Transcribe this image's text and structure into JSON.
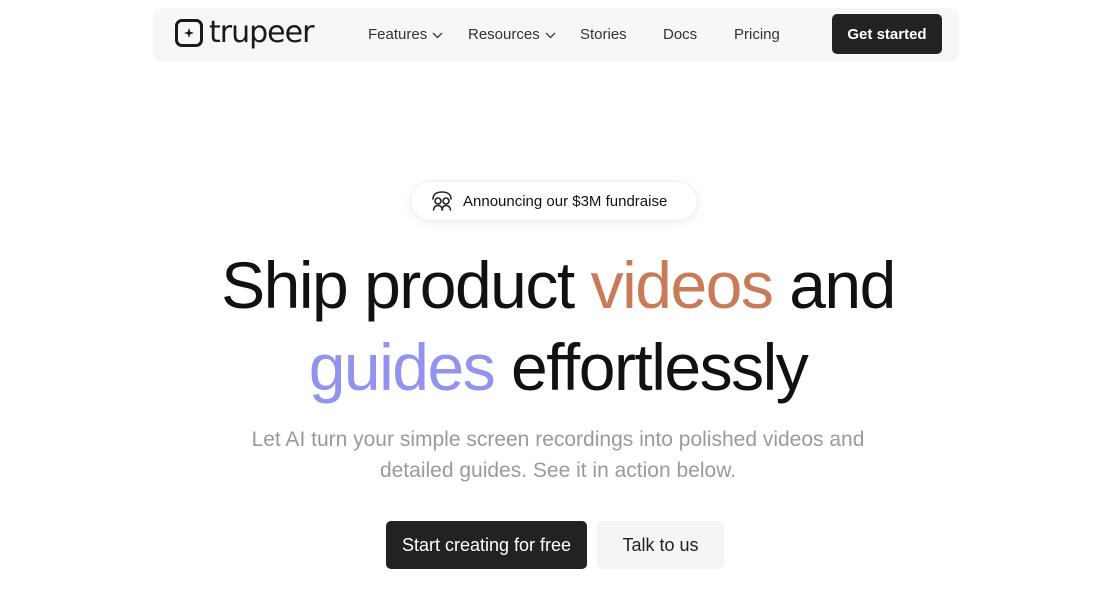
{
  "brand": {
    "name": "trupeer",
    "logo_icon": "sparkle-square-icon"
  },
  "nav": {
    "items": [
      {
        "label": "Features",
        "has_dropdown": true
      },
      {
        "label": "Resources",
        "has_dropdown": true
      },
      {
        "label": "Stories",
        "has_dropdown": false
      },
      {
        "label": "Docs",
        "has_dropdown": false
      },
      {
        "label": "Pricing",
        "has_dropdown": false
      }
    ],
    "cta_label": "Get started"
  },
  "announcement": {
    "icon": "people-icon",
    "text": "Announcing our $3M fundraise"
  },
  "hero": {
    "headline_part1": "Ship product",
    "headline_highlight1": "videos",
    "headline_part2": "and",
    "headline_highlight2": "guides",
    "headline_part3": "effortlessly",
    "subtitle_line1": "Let AI turn your simple screen recordings into polished videos and",
    "subtitle_line2": "detailed guides. See it in action below.",
    "primary_cta": "Start creating for free",
    "secondary_cta": "Talk to us"
  },
  "colors": {
    "highlight_orange": "#c97b58",
    "highlight_purple": "#9193ef",
    "button_dark": "#222222",
    "subtitle_gray": "#9a9a9a"
  }
}
